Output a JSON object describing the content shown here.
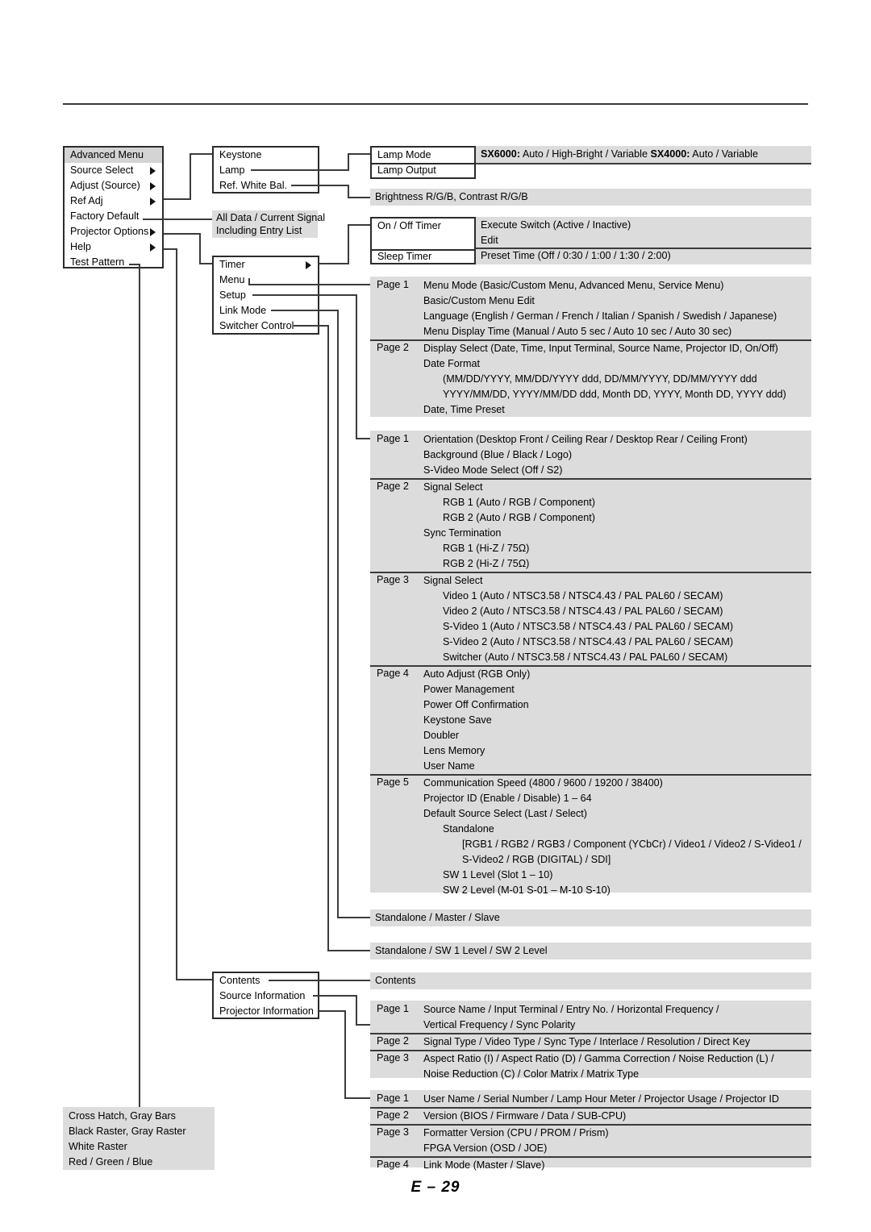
{
  "footer": {
    "page_label": "E – 29"
  },
  "colors": {
    "panel_grey": "#dcdcdc",
    "box_border": "#2b2b2b",
    "line": "#3b3b3b",
    "header_grey": "#d4d4d4"
  },
  "col1": {
    "main_menu": {
      "title": "Advanced Menu",
      "items": [
        {
          "label": "Source Select",
          "arrow": true
        },
        {
          "label": "Adjust (Source)",
          "arrow": true
        },
        {
          "label": "Ref Adj",
          "arrow": true
        },
        {
          "label": "Factory Default",
          "arrow": false
        },
        {
          "label": "Projector Options",
          "arrow": true
        },
        {
          "label": "Help",
          "arrow": true
        },
        {
          "label": "Test Pattern",
          "arrow": false
        }
      ]
    },
    "test_pattern_panel": {
      "lines": [
        "Cross Hatch, Gray Bars",
        "Black Raster, Gray Raster",
        "White Raster",
        "Red / Green / Blue"
      ]
    }
  },
  "col2": {
    "ref_adj_box": {
      "items": [
        "Keystone",
        "Lamp",
        "Ref. White Bal."
      ]
    },
    "factory_default_panel": {
      "lines": [
        "All Data / Current Signal",
        "Including Entry List"
      ]
    },
    "projector_options_box": {
      "items": [
        "Timer",
        "Menu",
        "Setup",
        "Link Mode",
        "Switcher Control"
      ]
    },
    "help_box": {
      "items": [
        "Contents",
        "Source Information",
        "Projector Information"
      ]
    }
  },
  "col3": {
    "lamp_box": {
      "items": [
        "Lamp Mode",
        "Lamp Output"
      ]
    },
    "lamp_mode_values": {
      "sx6000_label": "SX6000:",
      "sx6000_value": " Auto / High-Bright / Variable   ",
      "sx4000_label": "SX4000:",
      "sx4000_value": " Auto / Variable"
    },
    "ref_white_bal_panel": {
      "text": "Brightness R/G/B, Contrast R/G/B"
    },
    "timer_box": {
      "items": [
        "On / Off Timer",
        "Sleep Timer"
      ]
    },
    "timer_values": {
      "on_off": [
        "Execute Switch (Active / Inactive)",
        "Edit"
      ],
      "sleep": [
        "Preset Time (Off / 0:30 / 1:00 / 1:30 / 2:00)"
      ]
    },
    "menu_panel": {
      "pages": [
        {
          "page": "Page 1",
          "lines": [
            {
              "text": "Menu Mode (Basic/Custom Menu, Advanced Menu, Service Menu)",
              "indent": 0
            },
            {
              "text": "Basic/Custom Menu Edit",
              "indent": 0
            },
            {
              "text": "Language (English / German / French / Italian / Spanish / Swedish / Japanese)",
              "indent": 0
            },
            {
              "text": "Menu Display Time (Manual / Auto 5 sec / Auto 10 sec / Auto 30 sec)",
              "indent": 0
            }
          ]
        },
        {
          "page": "Page 2",
          "lines": [
            {
              "text": "Display Select (Date, Time, Input Terminal, Source Name, Projector ID, On/Off)",
              "indent": 0
            },
            {
              "text": "Date Format",
              "indent": 0
            },
            {
              "text": "(MM/DD/YYYY, MM/DD/YYYY ddd, DD/MM/YYYY, DD/MM/YYYY ddd",
              "indent": 1
            },
            {
              "text": "YYYY/MM/DD, YYYY/MM/DD ddd, Month DD, YYYY, Month DD, YYYY ddd)",
              "indent": 1
            },
            {
              "text": "Date, Time Preset",
              "indent": 0
            }
          ]
        }
      ]
    },
    "setup_panel": {
      "pages": [
        {
          "page": "Page 1",
          "lines": [
            {
              "text": "Orientation (Desktop Front / Ceiling Rear / Desktop Rear / Ceiling Front)",
              "indent": 0
            },
            {
              "text": "Background (Blue / Black / Logo)",
              "indent": 0
            },
            {
              "text": "S-Video Mode Select (Off / S2)",
              "indent": 0
            }
          ]
        },
        {
          "page": "Page 2",
          "lines": [
            {
              "text": "Signal Select",
              "indent": 0
            },
            {
              "text": "RGB 1 (Auto / RGB / Component)",
              "indent": 1
            },
            {
              "text": "RGB 2 (Auto / RGB / Component)",
              "indent": 1
            },
            {
              "text": "Sync Termination",
              "indent": 0
            },
            {
              "text": "RGB 1 (Hi-Z / 75Ω)",
              "indent": 1
            },
            {
              "text": "RGB 2 (Hi-Z / 75Ω)",
              "indent": 1
            }
          ]
        },
        {
          "page": "Page 3",
          "lines": [
            {
              "text": "Signal Select",
              "indent": 0
            },
            {
              "text": "Video 1 (Auto / NTSC3.58 / NTSC4.43 / PAL PAL60 / SECAM)",
              "indent": 1
            },
            {
              "text": "Video 2 (Auto / NTSC3.58 / NTSC4.43 / PAL PAL60 / SECAM)",
              "indent": 1
            },
            {
              "text": "S-Video 1 (Auto / NTSC3.58 / NTSC4.43 / PAL PAL60 / SECAM)",
              "indent": 1
            },
            {
              "text": "S-Video 2 (Auto / NTSC3.58 / NTSC4.43 / PAL PAL60 / SECAM)",
              "indent": 1
            },
            {
              "text": "Switcher (Auto / NTSC3.58 / NTSC4.43 / PAL PAL60 / SECAM)",
              "indent": 1
            }
          ]
        },
        {
          "page": "Page 4",
          "lines": [
            {
              "text": "Auto Adjust (RGB Only)",
              "indent": 0
            },
            {
              "text": "Power Management",
              "indent": 0
            },
            {
              "text": "Power Off Confirmation",
              "indent": 0
            },
            {
              "text": "Keystone Save",
              "indent": 0
            },
            {
              "text": "Doubler",
              "indent": 0
            },
            {
              "text": "Lens Memory",
              "indent": 0
            },
            {
              "text": "User Name",
              "indent": 0
            }
          ]
        },
        {
          "page": "Page 5",
          "lines": [
            {
              "text": "Communication Speed (4800 / 9600 / 19200 / 38400)",
              "indent": 0
            },
            {
              "text": "Projector ID (Enable / Disable) 1 – 64",
              "indent": 0
            },
            {
              "text": "Default Source Select (Last / Select)",
              "indent": 0
            },
            {
              "text": "Standalone",
              "indent": 1
            },
            {
              "text": "[RGB1 / RGB2 / RGB3 / Component (YCbCr) / Video1 / Video2 / S-Video1 /",
              "indent": 2
            },
            {
              "text": "S-Video2 / RGB (DIGITAL) / SDI]",
              "indent": 2
            },
            {
              "text": "SW 1 Level (Slot 1 – 10)",
              "indent": 1
            },
            {
              "text": "SW 2 Level (M-01 S-01 – M-10 S-10)",
              "indent": 1
            }
          ]
        }
      ]
    },
    "link_mode_panel": {
      "text": "Standalone / Master / Slave"
    },
    "switcher_control_panel": {
      "text": "Standalone / SW 1 Level / SW 2 Level"
    },
    "contents_panel": {
      "text": "Contents"
    },
    "source_information_panel": {
      "pages": [
        {
          "page": "Page 1",
          "lines": [
            {
              "text": "Source Name / Input Terminal / Entry No. / Horizontal Frequency /",
              "indent": 0
            },
            {
              "text": "Vertical Frequency / Sync Polarity",
              "indent": 0
            }
          ]
        },
        {
          "page": "Page 2",
          "lines": [
            {
              "text": "Signal Type / Video Type / Sync Type / Interlace / Resolution / Direct Key",
              "indent": 0
            }
          ]
        },
        {
          "page": "Page 3",
          "lines": [
            {
              "text": "Aspect Ratio (I) / Aspect Ratio (D) / Gamma Correction / Noise Reduction (L) /",
              "indent": 0
            },
            {
              "text": "Noise Reduction (C) / Color Matrix / Matrix Type",
              "indent": 0
            }
          ]
        }
      ]
    },
    "projector_information_panel": {
      "pages": [
        {
          "page": "Page 1",
          "lines": [
            {
              "text": "User Name / Serial Number / Lamp Hour Meter / Projector Usage / Projector ID",
              "indent": 0
            }
          ]
        },
        {
          "page": "Page 2",
          "lines": [
            {
              "text": "Version (BIOS / Firmware / Data / SUB-CPU)",
              "indent": 0
            }
          ]
        },
        {
          "page": "Page 3",
          "lines": [
            {
              "text": "Formatter Version (CPU / PROM / Prism)",
              "indent": 0
            },
            {
              "text": "FPGA Version (OSD / JOE)",
              "indent": 0
            }
          ]
        },
        {
          "page": "Page 4",
          "lines": [
            {
              "text": "Link Mode (Master / Slave)",
              "indent": 0
            }
          ]
        }
      ]
    }
  }
}
